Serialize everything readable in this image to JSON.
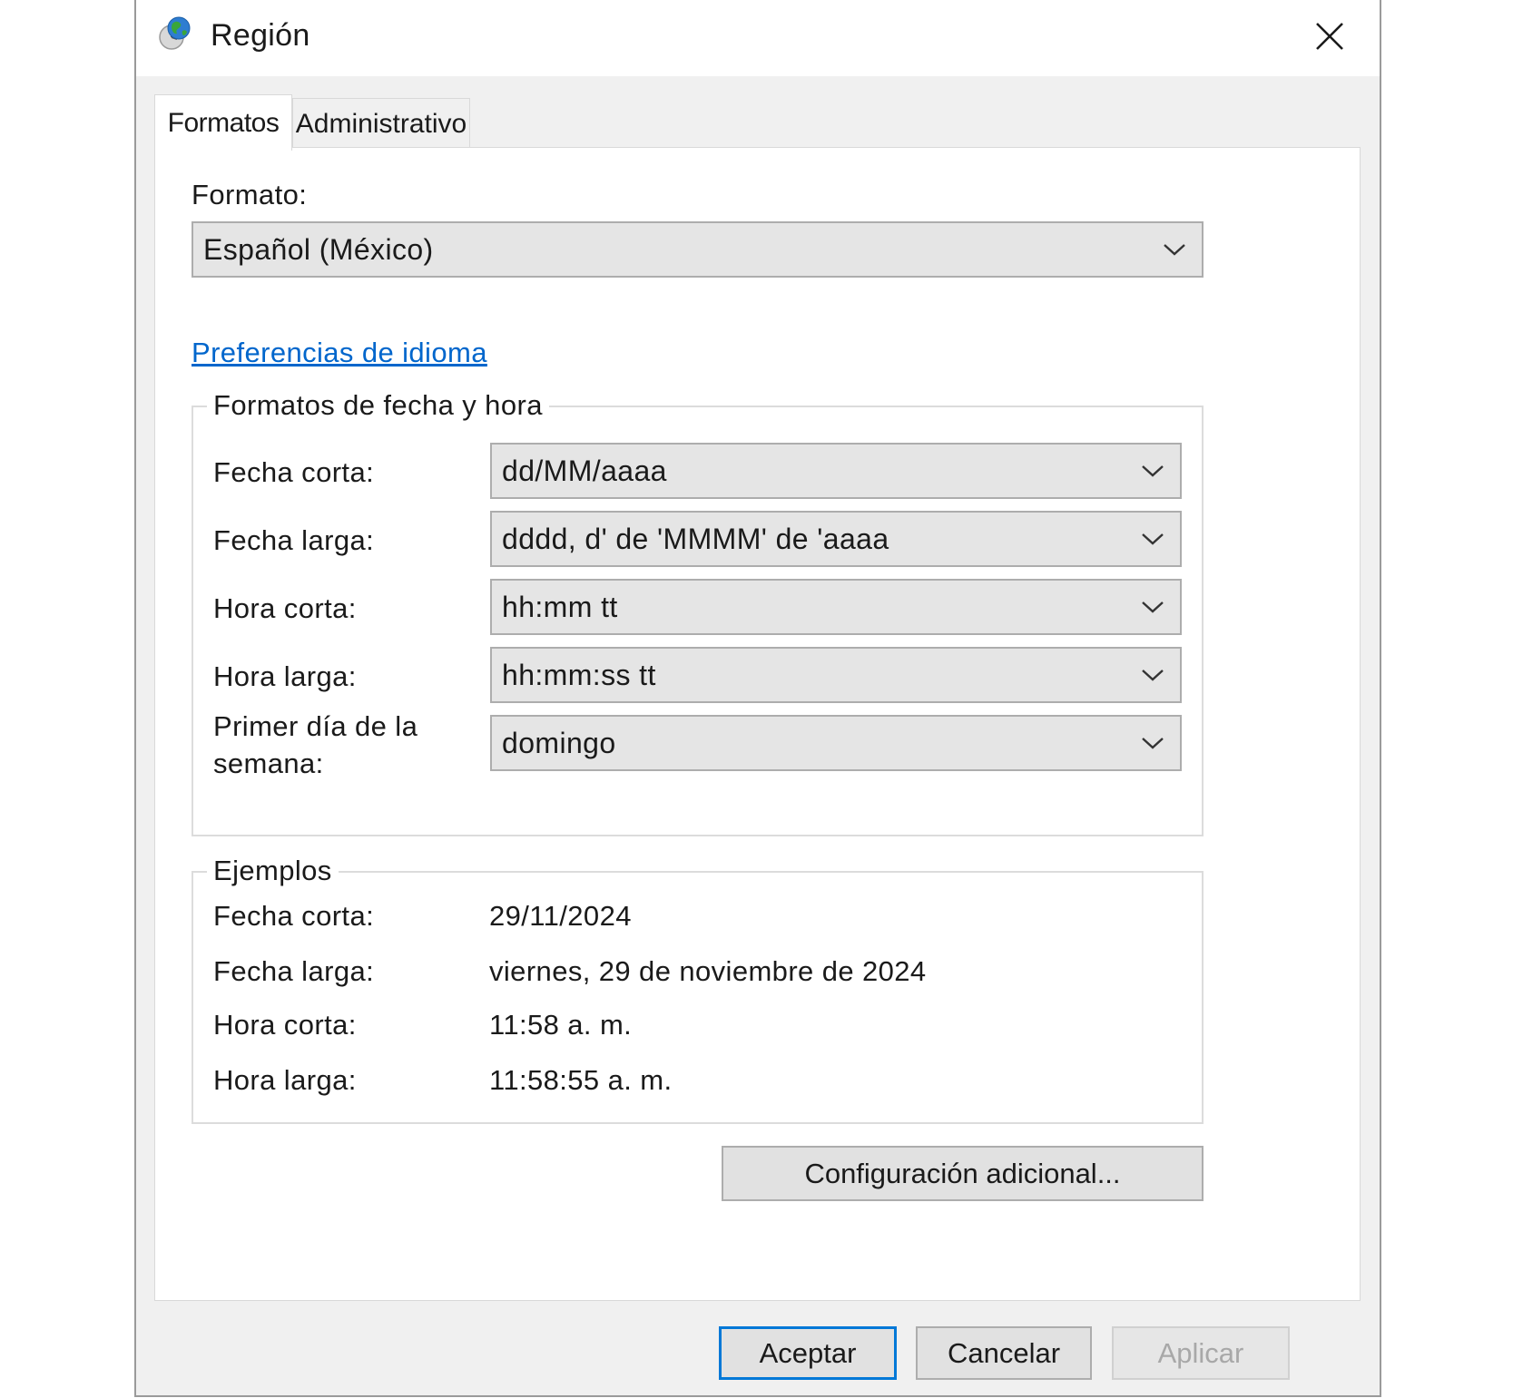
{
  "window": {
    "title": "Región",
    "icon": "globe-clock-icon"
  },
  "tabs": [
    {
      "label": "Formatos",
      "active": true
    },
    {
      "label": "Administrativo",
      "active": false
    }
  ],
  "format": {
    "label": "Formato:",
    "value": "Español (México)"
  },
  "language_link": "Preferencias de idioma",
  "datetime_group": {
    "title": "Formatos de fecha y hora",
    "rows": [
      {
        "label": "Fecha corta:",
        "value": "dd/MM/aaaa"
      },
      {
        "label": "Fecha larga:",
        "value": "dddd, d' de 'MMMM' de 'aaaa"
      },
      {
        "label": "Hora corta:",
        "value": "hh:mm tt"
      },
      {
        "label": "Hora larga:",
        "value": "hh:mm:ss tt"
      },
      {
        "label_line1": "Primer día de la",
        "label_line2": "semana:",
        "value": "domingo"
      }
    ]
  },
  "examples_group": {
    "title": "Ejemplos",
    "rows": [
      {
        "label": "Fecha corta:",
        "value": "29/11/2024"
      },
      {
        "label": "Fecha larga:",
        "value": "viernes, 29 de noviembre de 2024"
      },
      {
        "label": "Hora corta:",
        "value": "11:58 a. m."
      },
      {
        "label": "Hora larga:",
        "value": "11:58:55 a. m."
      }
    ]
  },
  "buttons": {
    "additional": "Configuración adicional...",
    "ok": "Aceptar",
    "cancel": "Cancelar",
    "apply": "Aplicar"
  },
  "colors": {
    "link": "#0066cc",
    "default_button_border": "#0078d7",
    "dialog_background": "#f0f0f0"
  }
}
